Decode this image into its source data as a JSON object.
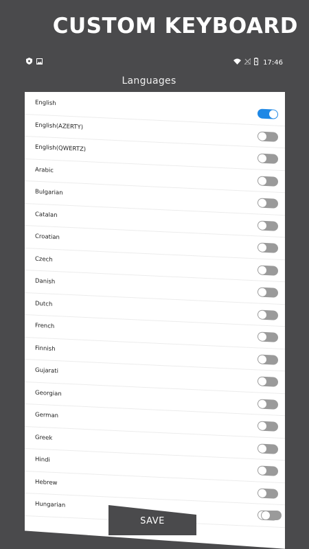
{
  "promo": {
    "title": "CUSTOM KEYBOARD"
  },
  "status_bar": {
    "time": "17:46",
    "left_icons": [
      "shield-icon",
      "image-icon"
    ],
    "right_icons": [
      "wifi-icon",
      "no-signal-icon",
      "battery-icon"
    ]
  },
  "screen": {
    "title": "Languages"
  },
  "languages": [
    {
      "label": "English",
      "enabled": true
    },
    {
      "label": "English(AZERTY)",
      "enabled": false
    },
    {
      "label": "English(QWERTZ)",
      "enabled": false
    },
    {
      "label": "Arabic",
      "enabled": false
    },
    {
      "label": "Bulgarian",
      "enabled": false
    },
    {
      "label": "Catalan",
      "enabled": false
    },
    {
      "label": "Croatian",
      "enabled": false
    },
    {
      "label": "Czech",
      "enabled": false
    },
    {
      "label": "Danish",
      "enabled": false
    },
    {
      "label": "Dutch",
      "enabled": false
    },
    {
      "label": "French",
      "enabled": false
    },
    {
      "label": "Finnish",
      "enabled": false
    },
    {
      "label": "Gujarati",
      "enabled": false
    },
    {
      "label": "Georgian",
      "enabled": false
    },
    {
      "label": "German",
      "enabled": false
    },
    {
      "label": "Greek",
      "enabled": false
    },
    {
      "label": "Hindi",
      "enabled": false
    },
    {
      "label": "Hebrew",
      "enabled": false
    },
    {
      "label": "Hungarian",
      "enabled": false
    }
  ],
  "extra_toggle": {
    "enabled": false
  },
  "save": {
    "label": "SAVE"
  },
  "colors": {
    "background": "#4a4a4c",
    "toggle_on": "#1e88e5",
    "toggle_off": "#9a9a9a",
    "sheet": "#ffffff"
  }
}
